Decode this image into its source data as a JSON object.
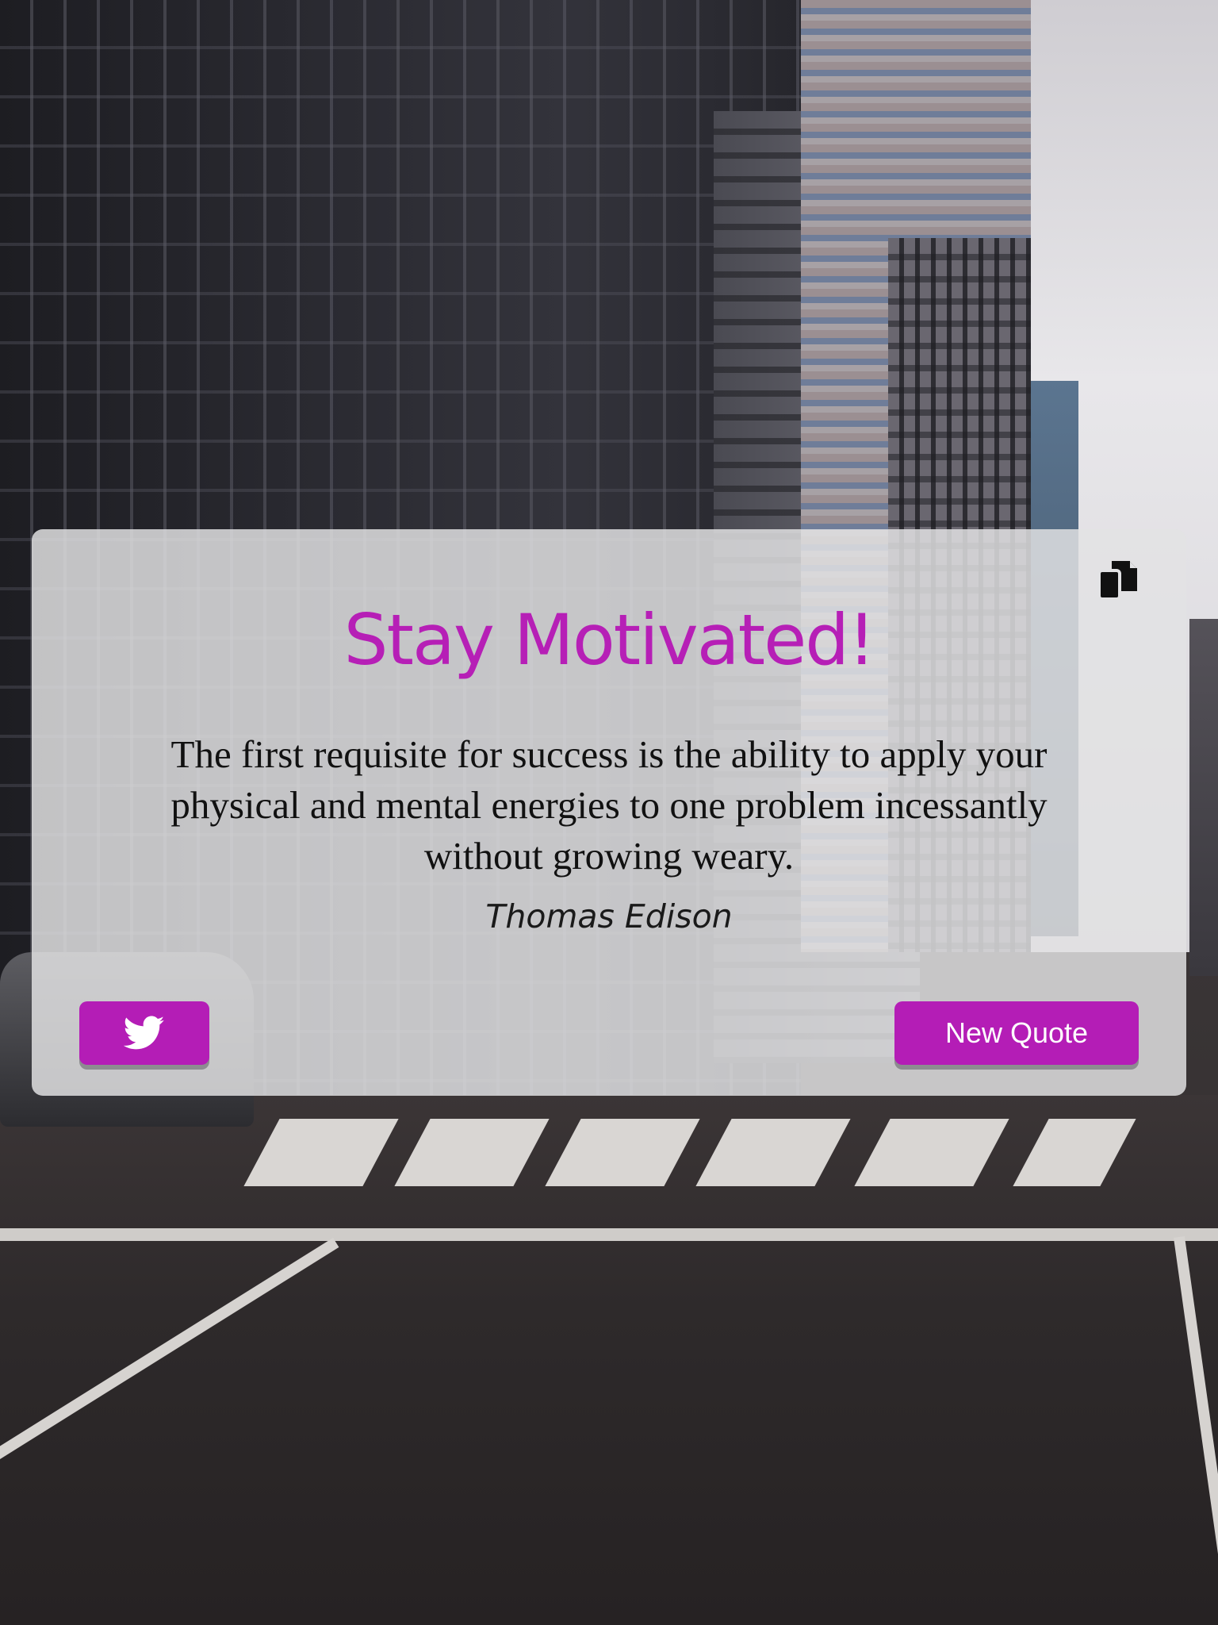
{
  "header": {
    "title": "Stay Motivated!"
  },
  "quote": {
    "text": "The first requisite for success is the ability to apply your physical and mental energies to one problem incessantly without growing weary.",
    "author": "Thomas Edison"
  },
  "actions": {
    "copy_icon": "copy-icon",
    "tweet_icon": "twitter-bird-icon",
    "new_quote_label": "New Quote"
  },
  "colors": {
    "accent": "#b41db6",
    "card_background": "#e2e2e4"
  }
}
